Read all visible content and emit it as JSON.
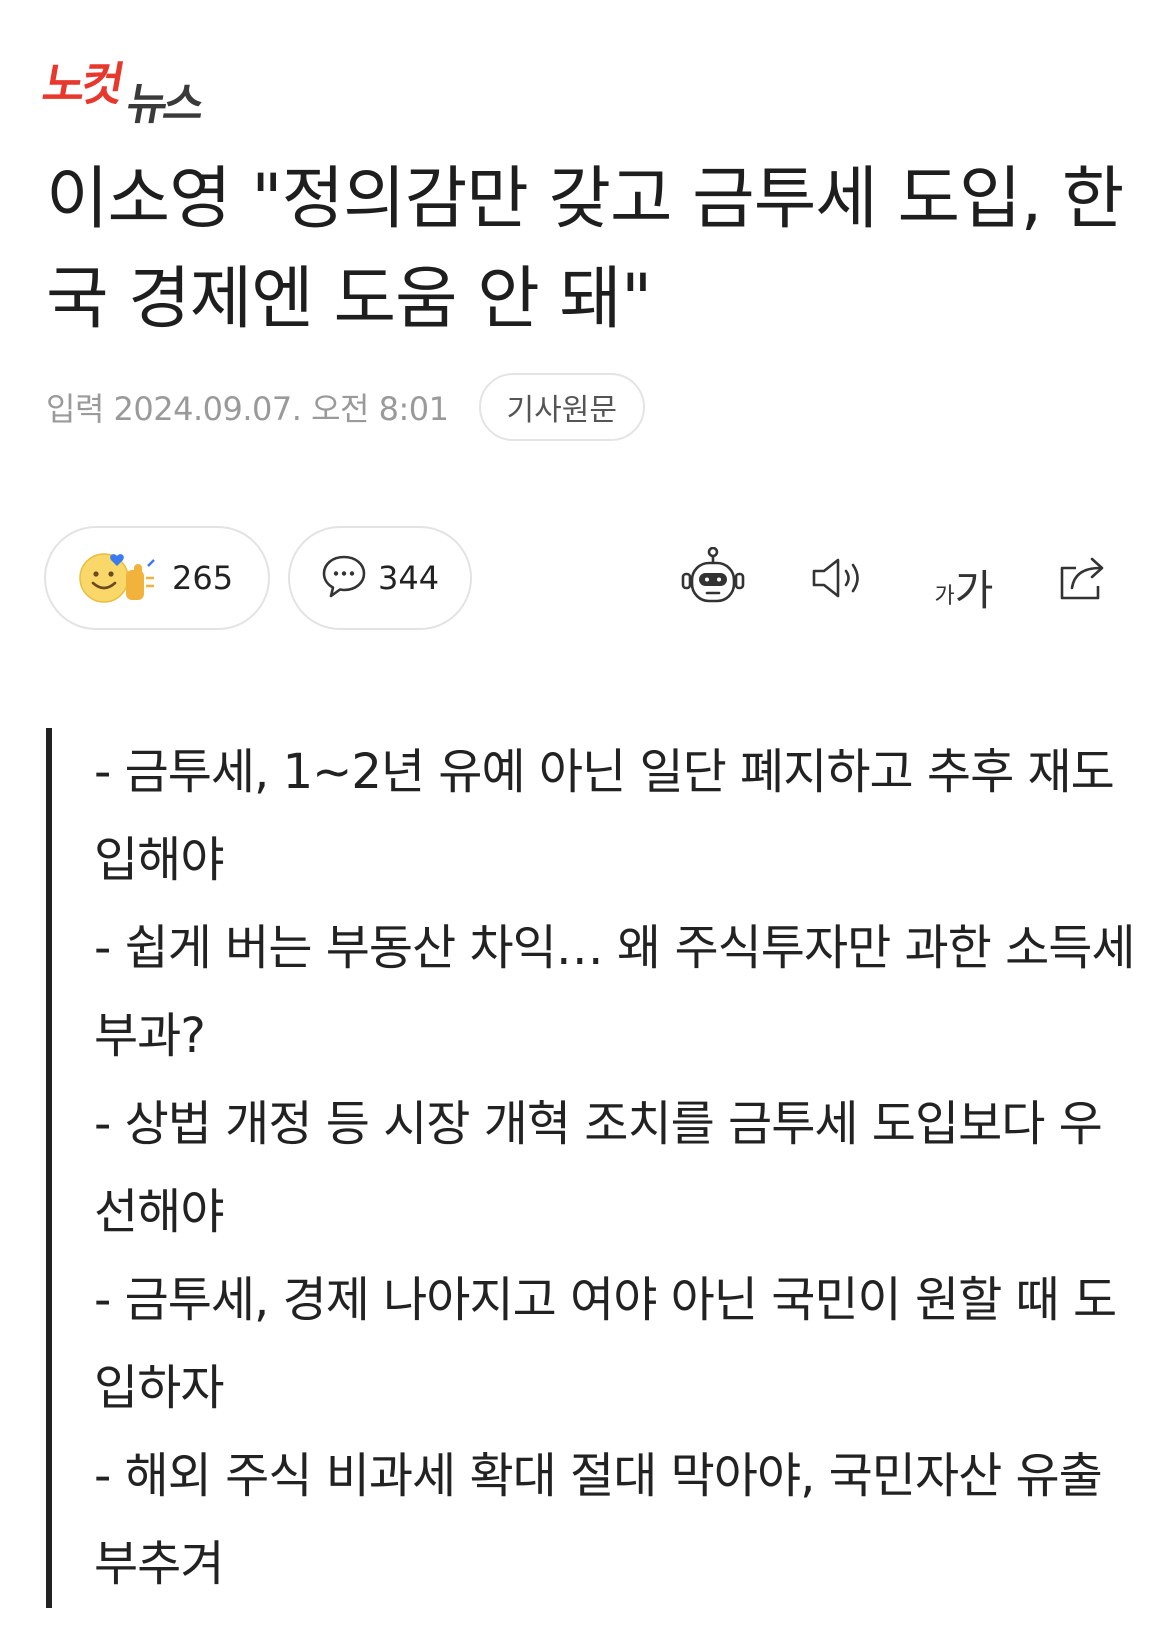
{
  "logo": {
    "part_a": "노컷",
    "part_b": "뉴스"
  },
  "headline": "이소영 \"정의감만 갖고 금투세 도입, 한국 경제엔 도움 안 돼\"",
  "meta": {
    "date": "입력 2024.09.07. 오전 8:01",
    "original_button": "기사원문"
  },
  "reactions": {
    "count": "265",
    "icon": "smile-emoji-reaction-icon"
  },
  "comments": {
    "count": "344",
    "icon": "speech-bubble-icon"
  },
  "toolbar": {
    "summary_bot_icon": "robot-icon",
    "audio_icon": "speaker-icon",
    "font_small": "가",
    "font_big": "가",
    "share_icon": "share-icon"
  },
  "summary": [
    "- 금투세, 1~2년 유예 아닌 일단 폐지하고 추후 재도입해야",
    "- 쉽게 버는 부동산 차익… 왜 주식투자만 과한 소득세 부과?",
    "- 상법 개정 등 시장 개혁 조치를 금투세 도입보다 우선해야",
    "- 금투세, 경제 나아지고 여야 아닌 국민이 원할 때 도입하자",
    "- 해외 주식 비과세 확대 절대 막아야, 국민자산 유출 부추겨"
  ],
  "colors": {
    "brand_red": "#e8382d",
    "text": "#222222",
    "muted": "#9a9a9a"
  }
}
